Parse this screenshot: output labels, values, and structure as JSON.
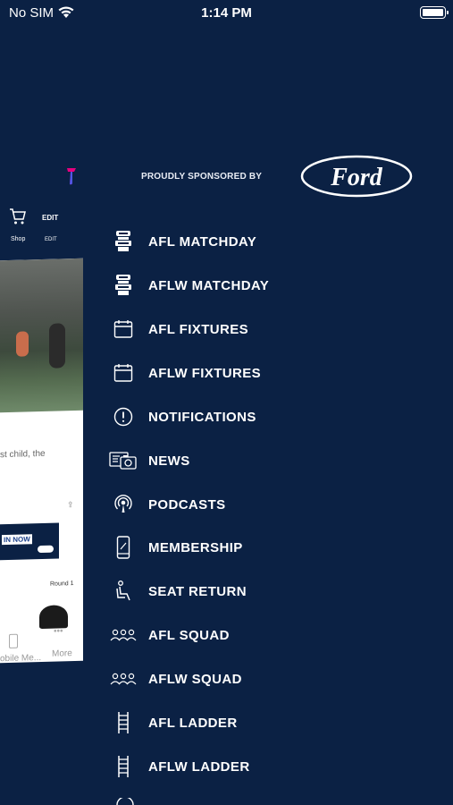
{
  "status": {
    "carrier": "No SIM",
    "time": "1:14 PM"
  },
  "preview": {
    "shop_label": "Shop",
    "edit_label": "EDIT",
    "edit_label_small": "EDIT",
    "article_snippet": "st child, the",
    "banner_text": "IN NOW",
    "round_label": "Round 1",
    "tab_label": "obile Me...",
    "more_label": "More"
  },
  "sponsor": {
    "label": "PROUDLY SPONSORED BY",
    "brand": "Ford"
  },
  "menu": {
    "items": [
      {
        "label": "AFL MATCHDAY",
        "icon": "stadium-icon"
      },
      {
        "label": "AFLW MATCHDAY",
        "icon": "stadium-icon"
      },
      {
        "label": "AFL FIXTURES",
        "icon": "calendar-icon"
      },
      {
        "label": "AFLW FIXTURES",
        "icon": "calendar-icon"
      },
      {
        "label": "NOTIFICATIONS",
        "icon": "alert-circle-icon"
      },
      {
        "label": "NEWS",
        "icon": "news-camera-icon"
      },
      {
        "label": "PODCASTS",
        "icon": "podcast-icon"
      },
      {
        "label": "MEMBERSHIP",
        "icon": "phone-icon"
      },
      {
        "label": "SEAT RETURN",
        "icon": "seat-icon"
      },
      {
        "label": "AFL SQUAD",
        "icon": "group-icon"
      },
      {
        "label": "AFLW SQUAD",
        "icon": "group-icon"
      },
      {
        "label": "AFL LADDER",
        "icon": "ladder-icon"
      },
      {
        "label": "AFLW LADDER",
        "icon": "ladder-icon"
      }
    ]
  }
}
